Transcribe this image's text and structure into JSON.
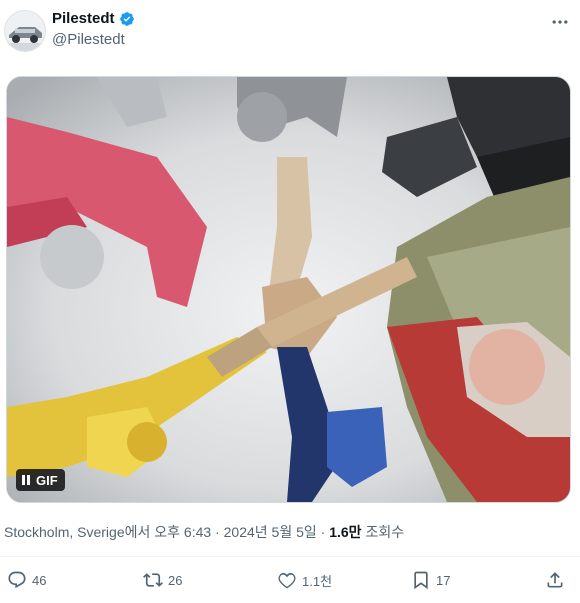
{
  "author": {
    "name": "Pilestedt",
    "handle": "@Pilestedt",
    "verified": true
  },
  "media": {
    "type": "GIF",
    "badge_label": "GIF",
    "state": "playing"
  },
  "meta": {
    "location": "Stockholm, Sverige에서",
    "time": "오후 6:43",
    "separator1": "·",
    "date": "2024년 5월 5일",
    "separator2": "·",
    "views_count": "1.6만",
    "views_label": "조회수"
  },
  "actions": {
    "replies": "46",
    "reposts": "26",
    "likes": "1.1천",
    "bookmarks": "17"
  },
  "colors": {
    "text": "#0f1419",
    "secondary": "#536471",
    "verified": "#1d9bf0"
  },
  "icons": [
    "verified-icon",
    "more-icon",
    "pause-icon",
    "reply-icon",
    "repost-icon",
    "like-icon",
    "bookmark-icon",
    "share-icon"
  ]
}
